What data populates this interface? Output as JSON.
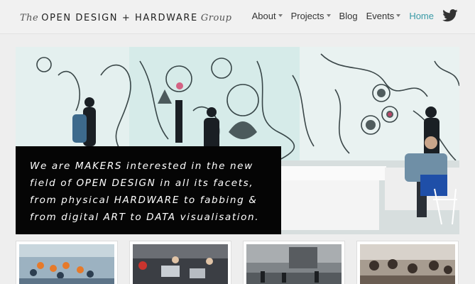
{
  "brand": {
    "prefix": "The",
    "name": "OPEN DESIGN + HARDWARE",
    "suffix": "Group"
  },
  "nav": {
    "items": [
      {
        "label": "About",
        "dropdown": true
      },
      {
        "label": "Projects",
        "dropdown": true
      },
      {
        "label": "Blog",
        "dropdown": false
      },
      {
        "label": "Events",
        "dropdown": true
      },
      {
        "label": "Home",
        "dropdown": false,
        "active": true
      }
    ],
    "twitter_icon": "twitter-bird-icon",
    "active_color": "#3a9aa6"
  },
  "hero": {
    "tagline_lines": [
      "We are MAKERS interested in the new",
      "field of OPEN DESIGN in all its facets,",
      "from physical HARDWARE to fabbing &",
      "from digital ART to DATA visualisation."
    ],
    "image": "photo of a studio with graffiti-covered walls and people working at white tables"
  },
  "thumbnails": [
    {
      "name": "group-photo-orange-shirts"
    },
    {
      "name": "workshop-laptops"
    },
    {
      "name": "conference-hall"
    },
    {
      "name": "crowd-event"
    }
  ]
}
